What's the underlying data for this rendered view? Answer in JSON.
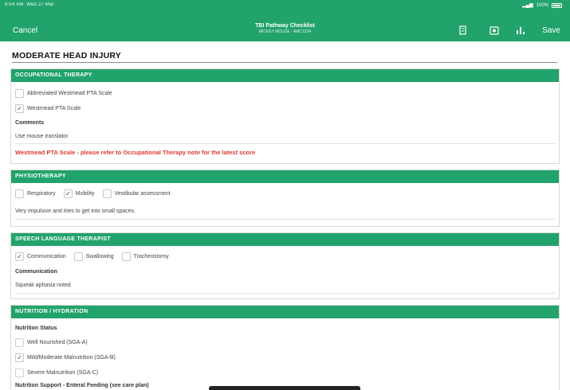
{
  "status_bar": {
    "time": "9:54 AM",
    "date": "Wed 27 Mar",
    "battery": "100%"
  },
  "nav": {
    "cancel_label": "Cancel",
    "title": "TBI Pathway Checklist",
    "subtitle": "MICKEY MOUSE - AMC1234",
    "save_label": "Save",
    "icons": [
      "document-icon",
      "camera-icon",
      "chart-icon"
    ]
  },
  "page_heading": "MODERATE HEAD INJURY",
  "sections": {
    "ot": {
      "title": "OCCUPATIONAL THERAPY",
      "options": [
        {
          "label": "Abbreviated Westmead PTA Scale",
          "checked": false
        },
        {
          "label": "Westmead PTA Scale",
          "checked": true
        }
      ],
      "comments_label": "Comments",
      "comments_value": "Use mouse translator",
      "warning": "Westmead PTA Scale - please refer to Occupational Therapy note for the latest score"
    },
    "physio": {
      "title": "PHYSIOTHERAPY",
      "options": [
        {
          "label": "Respiratory",
          "checked": false
        },
        {
          "label": "Mobility",
          "checked": true
        },
        {
          "label": "Vestibular assessment",
          "checked": false
        }
      ],
      "note": "Very impulsive and tries to get into small spaces."
    },
    "slt": {
      "title": "SPEECH LANGUAGE THERAPIST",
      "options": [
        {
          "label": "Communication",
          "checked": true
        },
        {
          "label": "Swallowing",
          "checked": false
        },
        {
          "label": "Tracheostomy",
          "checked": false
        }
      ],
      "comm_label": "Communication",
      "comm_value": "Squeak aphasia noted"
    },
    "nutrition": {
      "title": "NUTRITION / HYDRATION",
      "status_label": "Nutrition Status",
      "options": [
        {
          "label": "Well Nourished (SGA-A)",
          "checked": false
        },
        {
          "label": "Mild/Moderate Malnutrition (SGA-B)",
          "checked": true
        },
        {
          "label": "Severe Malnutrition (SGA-C)",
          "checked": false
        }
      ],
      "support_label": "Nutrition Support - Enteral Feeding (see care plan)"
    }
  }
}
